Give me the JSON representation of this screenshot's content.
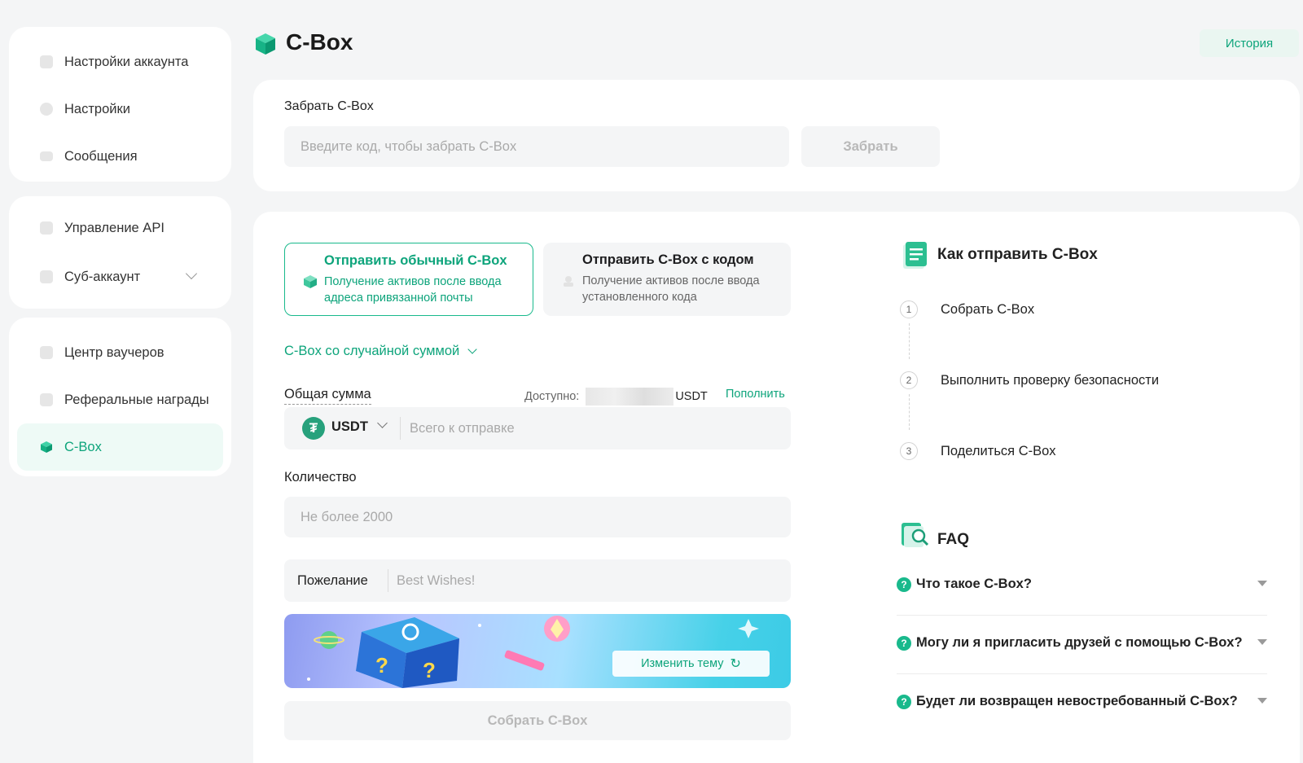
{
  "sidebar": {
    "group1": [
      {
        "label": "Настройки аккаунта",
        "icon": "user-icon"
      },
      {
        "label": "Настройки",
        "icon": "settings-icon"
      },
      {
        "label": "Сообщения",
        "icon": "message-icon"
      }
    ],
    "group2": [
      {
        "label": "Управление API",
        "icon": "api-icon"
      },
      {
        "label": "Суб-аккаунт",
        "icon": "subaccount-icon"
      }
    ],
    "group3": [
      {
        "label": "Центр ваучеров",
        "icon": "voucher-icon"
      },
      {
        "label": "Реферальные награды",
        "icon": "referral-icon"
      },
      {
        "label": "C-Box",
        "icon": "cbox-icon"
      }
    ]
  },
  "header": {
    "title": "C-Box",
    "history": "История"
  },
  "claim": {
    "label": "Забрать C-Box",
    "placeholder": "Введите код, чтобы забрать C-Box",
    "button": "Забрать"
  },
  "send_types": {
    "regular": {
      "title": "Отправить обычный C-Box",
      "desc": "Получение активов после ввода адреса привязанной почты"
    },
    "code": {
      "title": "Отправить C-Box с кодом",
      "desc": "Получение активов после ввода установленного кода"
    }
  },
  "form": {
    "random_mode": "C-Box со случайной суммой",
    "total_label": "Общая сумма",
    "available_label": "Доступно:",
    "available_unit": "USDT",
    "topup": "Пополнить",
    "coin": "USDT",
    "coin_symbol": "₮",
    "amount_placeholder": "Всего к отправке",
    "qty_label": "Количество",
    "qty_placeholder": "Не более 2000",
    "wish_label": "Пожелание",
    "wish_placeholder": "Best Wishes!",
    "change_theme": "Изменить тему",
    "collect": "Собрать C-Box"
  },
  "howto": {
    "title": "Как отправить C-Box",
    "steps": [
      {
        "num": "1",
        "label": "Собрать C-Box"
      },
      {
        "num": "2",
        "label": "Выполнить проверку безопасности"
      },
      {
        "num": "3",
        "label": "Поделиться C-Box"
      }
    ]
  },
  "faq": {
    "title": "FAQ",
    "items": [
      "Что такое C-Box?",
      "Могу ли я пригласить друзей с помощью C-Box?",
      "Будет ли возвращен невостребованный C-Box?"
    ]
  },
  "colors": {
    "accent": "#0da47b",
    "background": "#f4f5f6",
    "card": "#ffffff"
  }
}
